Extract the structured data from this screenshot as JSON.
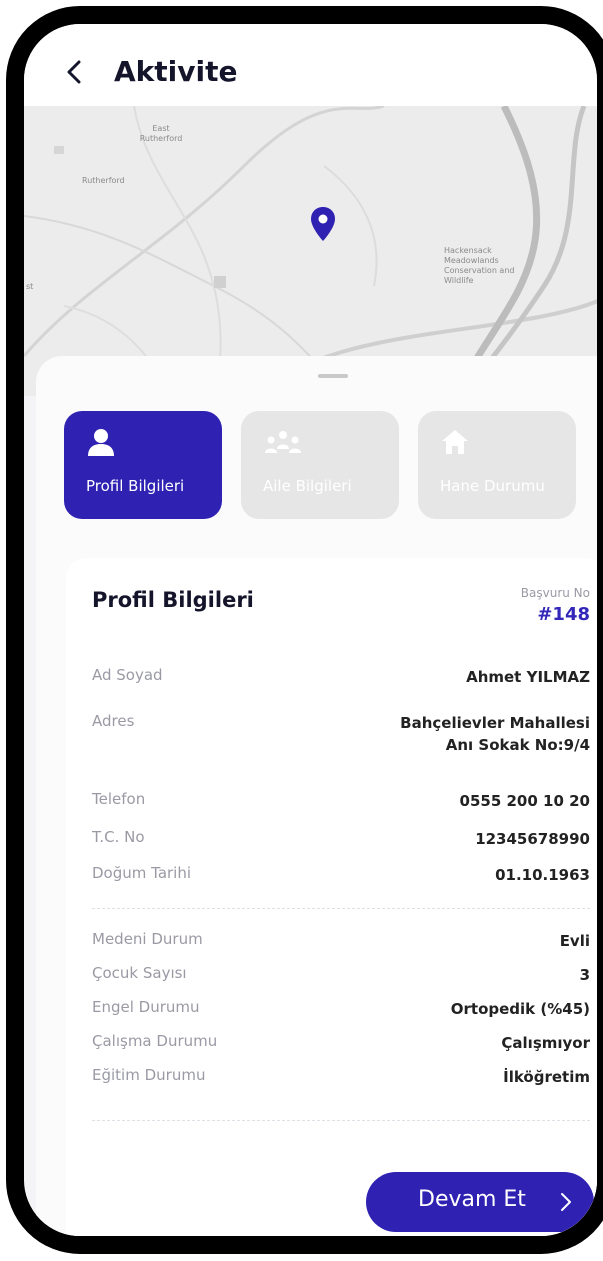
{
  "header": {
    "title": "Aktivite",
    "back_icon": "chevron-left-icon"
  },
  "map": {
    "labels": [
      "East Rutherford",
      "Rutherford",
      "st",
      "Hackensack Meadowlands Conservation and Wildlife"
    ],
    "pin_color": "#2f22b2"
  },
  "tabs": [
    {
      "label": "Profil Bilgileri",
      "icon": "user-icon",
      "active": true
    },
    {
      "label": "Aile Bilgileri",
      "icon": "people-icon",
      "active": false
    },
    {
      "label": "Hane Durumu",
      "icon": "home-icon",
      "active": false
    }
  ],
  "profile": {
    "title": "Profil Bilgileri",
    "application_label": "Başvuru No",
    "application_no": "#148",
    "fields": [
      {
        "label": "Ad Soyad",
        "value": "Ahmet YILMAZ"
      },
      {
        "label": "Adres",
        "value_line1": "Bahçelievler Mahallesi",
        "value_line2": "Anı Sokak No:9/4"
      },
      {
        "label": "Telefon",
        "value": "0555 200 10 20"
      },
      {
        "label": "T.C. No",
        "value": "12345678990"
      },
      {
        "label": "Doğum Tarihi",
        "value": "01.10.1963"
      },
      {
        "label": "Medeni Durum",
        "value": "Evli"
      },
      {
        "label": "Çocuk Sayısı",
        "value": "3"
      },
      {
        "label": "Engel Durumu",
        "value": "Ortopedik (%45)"
      },
      {
        "label": "Çalışma Durumu",
        "value": "Çalışmıyor"
      },
      {
        "label": "Eğitim Durumu",
        "value": "İlköğretim"
      }
    ]
  },
  "actions": {
    "continue_label": "Devam Et"
  },
  "colors": {
    "primary": "#2f22b2",
    "inactive_tab": "#e6e6e6"
  }
}
